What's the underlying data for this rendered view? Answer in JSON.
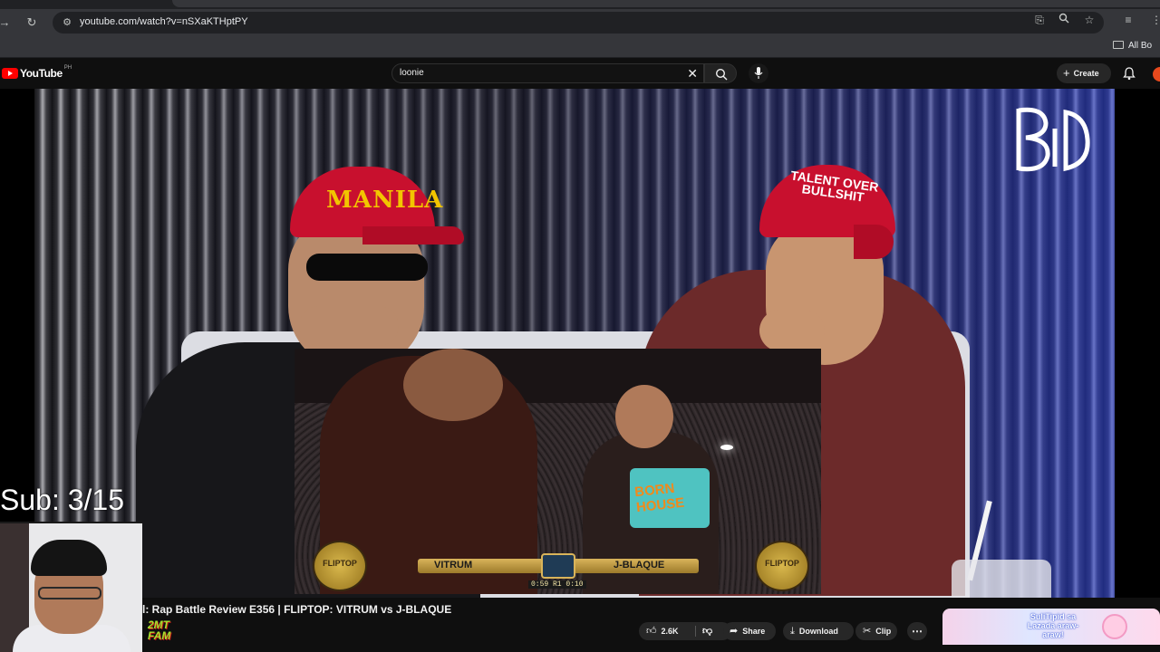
{
  "browser": {
    "url": "youtube.com/watch?v=nSXaKTHptPY",
    "bookmarks_folder": "All Bo"
  },
  "youtube": {
    "logo_text": "YouTube",
    "country_code": "PH",
    "search_query": "loonie",
    "create_label": "Create"
  },
  "player": {
    "watermark_logo": "BID",
    "cap_left_text": "MANILA",
    "cap_right_text": "TALENT OVER BULLSHIT",
    "inset": {
      "shirt_text": "BORN HOUSE",
      "emblem_text": "FLIPTOP",
      "battler_left": "VITRUM",
      "battler_right": "J-BLAQUE",
      "timer": "0:59 R1 0:10"
    }
  },
  "overlay": {
    "sub_count": "Sub: 3/15"
  },
  "video": {
    "title": "l: Rap Battle Review E356 | FLIPTOP: VITRUM vs J-BLAQUE",
    "channel_logo_text": "2MT FAM",
    "likes": "2.6K",
    "share_label": "Share",
    "download_label": "Download",
    "clip_label": "Clip",
    "more_label": "⋯"
  },
  "ad": {
    "text": "SuliTipid sa Lazada araw-araw!"
  },
  "colors": {
    "youtube_red": "#ff0000",
    "cap_red": "#c8102e",
    "chrome_bg": "#35363a",
    "page_bg": "#0f0f0f"
  }
}
